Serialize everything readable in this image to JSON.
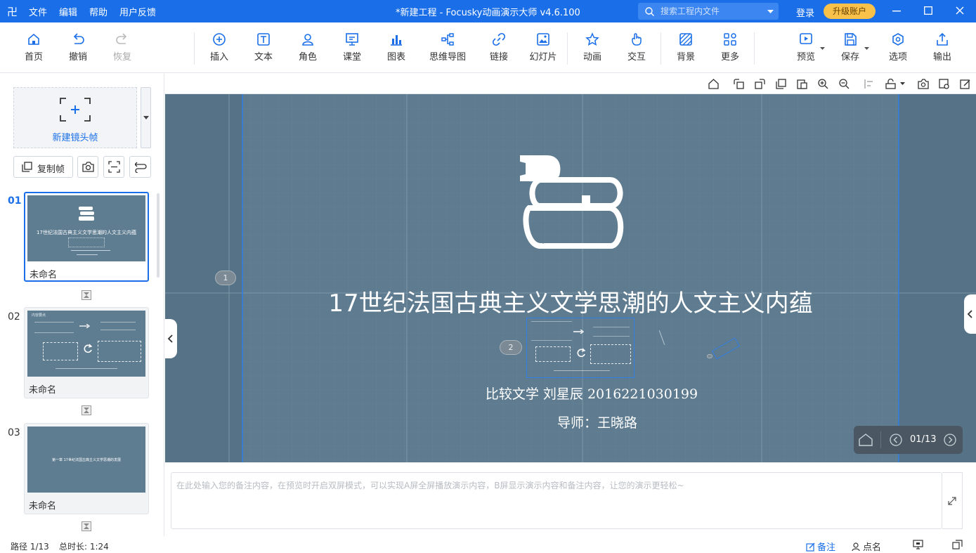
{
  "titlebar": {
    "app_logo": "卍",
    "menus": [
      "文件",
      "编辑",
      "帮助",
      "用户反馈"
    ],
    "title": "*新建工程 - Focusky动画演示大师  v4.6.100",
    "search_placeholder": "搜索工程内文件",
    "login": "登录",
    "upgrade": "升级账户"
  },
  "toolbar": {
    "left": [
      {
        "label": "首页",
        "icon": "home-icon"
      },
      {
        "label": "撤销",
        "icon": "undo-icon"
      },
      {
        "label": "恢复",
        "icon": "redo-icon",
        "disabled": true
      }
    ],
    "middle": [
      {
        "label": "插入",
        "icon": "plus-circle-icon"
      },
      {
        "label": "文本",
        "icon": "text-icon"
      },
      {
        "label": "角色",
        "icon": "character-icon"
      },
      {
        "label": "课堂",
        "icon": "classroom-icon"
      },
      {
        "label": "图表",
        "icon": "bar-chart-icon"
      },
      {
        "label": "思维导图",
        "icon": "mindmap-icon"
      },
      {
        "label": "链接",
        "icon": "link-icon"
      },
      {
        "label": "幻灯片",
        "icon": "slides-icon"
      }
    ],
    "middle2": [
      {
        "label": "动画",
        "icon": "star-icon"
      },
      {
        "label": "交互",
        "icon": "hand-icon"
      }
    ],
    "middle3": [
      {
        "label": "背景",
        "icon": "background-icon"
      },
      {
        "label": "更多",
        "icon": "more-grid-icon"
      }
    ],
    "right": [
      {
        "label": "预览",
        "icon": "preview-icon"
      },
      {
        "label": "保存",
        "icon": "save-icon"
      },
      {
        "label": "选项",
        "icon": "options-icon"
      },
      {
        "label": "输出",
        "icon": "export-icon"
      }
    ]
  },
  "sidebar": {
    "new_frame": "新建镜头帧",
    "copy_frame": "复制帧",
    "slides": [
      {
        "num": "01",
        "name": "未命名",
        "thumb_title": "17世纪法国古典主义文学思潮的人文主义内蕴"
      },
      {
        "num": "02",
        "name": "未命名",
        "thumb_title": "内容要点"
      },
      {
        "num": "03",
        "name": "未命名",
        "thumb_title": "第一章 17世纪法国古典主义文学思潮的发展"
      }
    ]
  },
  "stage": {
    "title": "17世纪法国古典主义文学思潮的人文主义内蕴",
    "subtitle": "比较文学    刘星辰  2016221030199",
    "advisor": "导师：王晓路",
    "markers": [
      "1",
      "2"
    ],
    "page_counter": "01/13"
  },
  "notes": {
    "placeholder": "在此处输入您的备注内容，在预览时开启双屏模式，可以实现A屏全屏播放演示内容，B屏显示演示内容和备注内容，让您的演示更轻松~"
  },
  "status": {
    "path": "路径 1/13",
    "duration": "总时长: 1:24",
    "notes_tab": "备注",
    "rollcall_tab": "点名"
  },
  "colors": {
    "accent": "#1a6fe8",
    "stage_bg": "#5e7b8f",
    "upgrade": "#f7c14a"
  }
}
